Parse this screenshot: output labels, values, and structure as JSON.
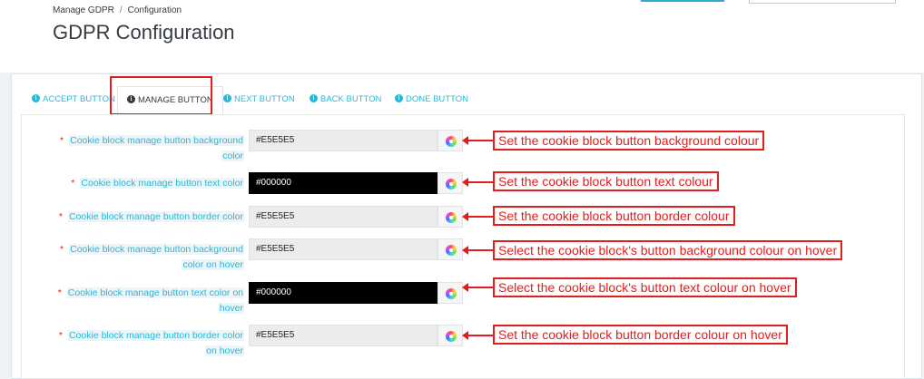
{
  "breadcrumb": {
    "parent": "Manage GDPR",
    "separator": "/",
    "current": "Configuration"
  },
  "page_title": "GDPR Configuration",
  "tabs": [
    {
      "label": "ACCEPT BUTTON",
      "icon": "info-icon",
      "active": false
    },
    {
      "label": "MANAGE BUTTON",
      "icon": "info-icon",
      "active": true
    },
    {
      "label": "NEXT BUTTON",
      "icon": "info-icon",
      "active": false
    },
    {
      "label": "BACK BUTTON",
      "icon": "info-icon",
      "active": false
    },
    {
      "label": "DONE BUTTON",
      "icon": "info-icon",
      "active": false
    }
  ],
  "fields": [
    {
      "label_line1": "Cookie block manage button background",
      "label_line2": "color",
      "value": "#E5E5E5",
      "required": "*"
    },
    {
      "label_line1": "Cookie block manage button text color",
      "label_line2": "",
      "value": "#000000",
      "required": "*"
    },
    {
      "label_line1": "Cookie block manage button border color",
      "label_line2": "",
      "value": "#E5E5E5",
      "required": "*"
    },
    {
      "label_line1": "Cookie block manage button background",
      "label_line2": "color on hover",
      "value": "#E5E5E5",
      "required": "*"
    },
    {
      "label_line1": "Cookie block manage button text color on",
      "label_line2": "hover",
      "value": "#000000",
      "required": "*"
    },
    {
      "label_line1": "Cookie block manage button border color",
      "label_line2": "on hover",
      "value": "#E5E5E5",
      "required": "*"
    }
  ],
  "annotations": [
    "Set the cookie block button background colour",
    "Set the cookie block button text colour",
    "Set the cookie block button border colour",
    "Select the cookie block's button background colour on hover",
    "Select the cookie block's button text colour on hover",
    "Set the cookie block button border colour on hover"
  ],
  "colors": {
    "accent": "#25b9d7",
    "annotation_red": "#e41c1c",
    "dark_swatch": "#000000",
    "light_swatch": "#ececec"
  }
}
